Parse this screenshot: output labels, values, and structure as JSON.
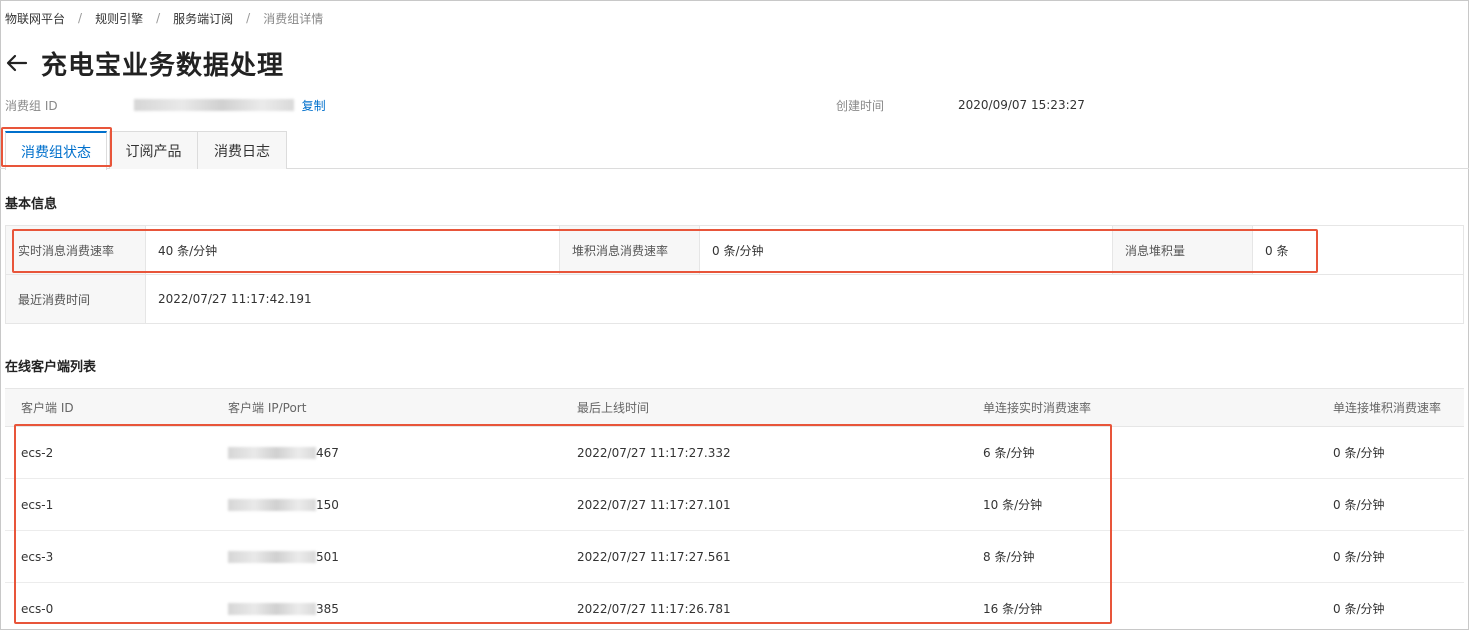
{
  "breadcrumb": [
    "物联网平台",
    "规则引擎",
    "服务端订阅",
    "消费组详情"
  ],
  "breadcrumb_separator": "/",
  "page_title": "充电宝业务数据处理",
  "meta": {
    "consumer_group_id_label": "消费组 ID",
    "copy_label": "复制",
    "created_time_label": "创建时间",
    "created_time_value": "2020/09/07 15:23:27"
  },
  "tabs": [
    {
      "label": "消费组状态",
      "active": true
    },
    {
      "label": "订阅产品",
      "active": false
    },
    {
      "label": "消费日志",
      "active": false
    }
  ],
  "basic_info": {
    "title": "基本信息",
    "realtime_rate_label": "实时消息消费速率",
    "realtime_rate_value": "40 条/分钟",
    "backlog_rate_label": "堆积消息消费速率",
    "backlog_rate_value": "0 条/分钟",
    "backlog_count_label": "消息堆积量",
    "backlog_count_value": "0 条",
    "last_consume_label": "最近消费时间",
    "last_consume_value": "2022/07/27 11:17:42.191"
  },
  "clients": {
    "title": "在线客户端列表",
    "columns": [
      "客户端 ID",
      "客户端 IP/Port",
      "最后上线时间",
      "单连接实时消费速率",
      "单连接堆积消费速率"
    ],
    "rows": [
      {
        "id": "ecs-2",
        "ip_suffix": "467",
        "last_online": "2022/07/27 11:17:27.332",
        "realtime_rate": "6 条/分钟",
        "backlog_rate": "0 条/分钟"
      },
      {
        "id": "ecs-1",
        "ip_suffix": "150",
        "last_online": "2022/07/27 11:17:27.101",
        "realtime_rate": "10 条/分钟",
        "backlog_rate": "0 条/分钟"
      },
      {
        "id": "ecs-3",
        "ip_suffix": "501",
        "last_online": "2022/07/27 11:17:27.561",
        "realtime_rate": "8 条/分钟",
        "backlog_rate": "0 条/分钟"
      },
      {
        "id": "ecs-0",
        "ip_suffix": "385",
        "last_online": "2022/07/27 11:17:26.781",
        "realtime_rate": "16 条/分钟",
        "backlog_rate": "0 条/分钟"
      }
    ]
  },
  "colors": {
    "accent": "#0070cc",
    "highlight": "#e8553a"
  },
  "icons": {
    "back": "arrow-left-icon"
  }
}
